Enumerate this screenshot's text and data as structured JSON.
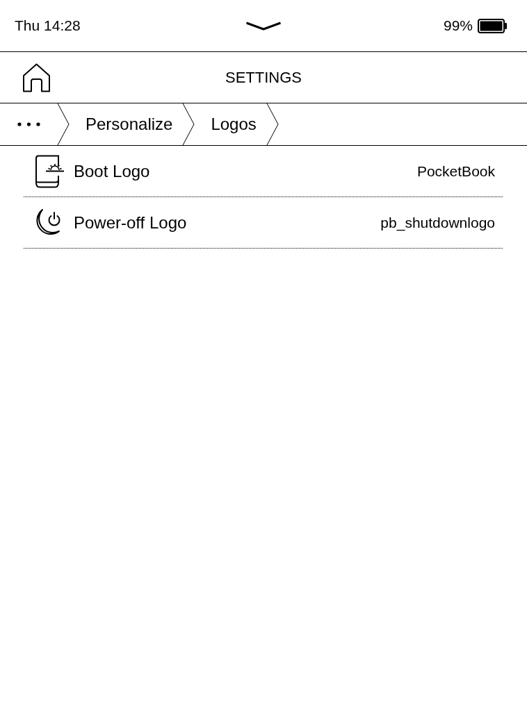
{
  "status_bar": {
    "time": "Thu 14:28",
    "battery": "99%"
  },
  "header": {
    "title": "SETTINGS"
  },
  "breadcrumb": {
    "items": [
      {
        "label": "Personalize"
      },
      {
        "label": "Logos"
      }
    ]
  },
  "settings": [
    {
      "kind": "boot",
      "label": "Boot Logo",
      "value": "PocketBook"
    },
    {
      "kind": "poweroff",
      "label": "Power-off Logo",
      "value": "pb_shutdownlogo"
    }
  ]
}
